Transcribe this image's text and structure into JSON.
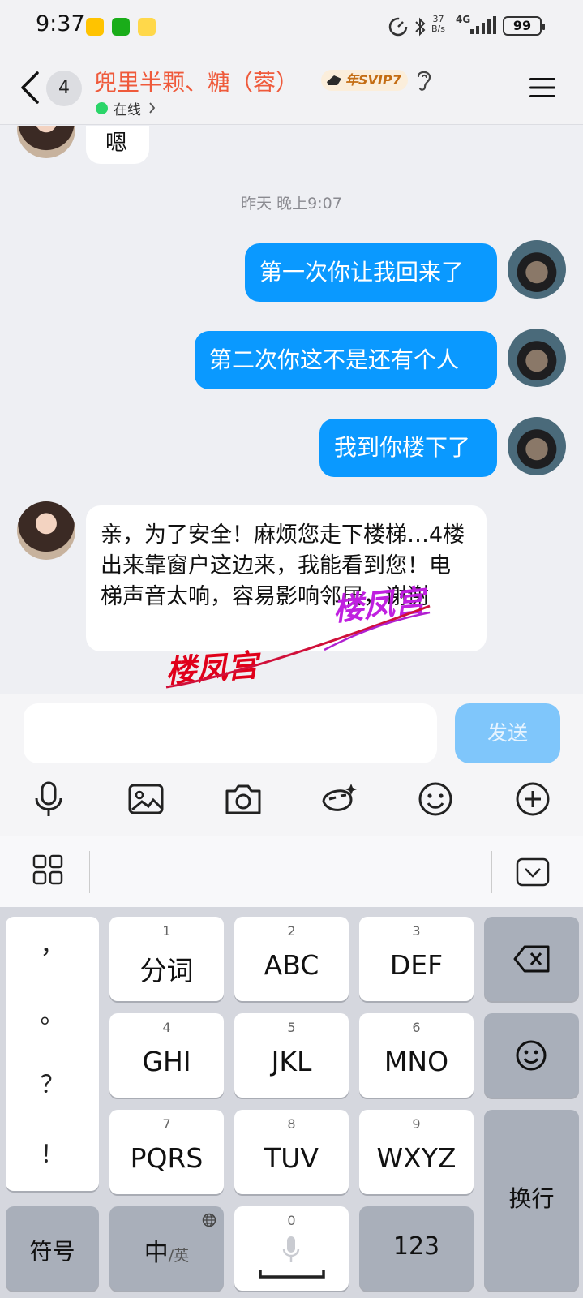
{
  "status": {
    "time": "9:37",
    "net_speed_top": "37",
    "net_speed_bottom": "B/s",
    "network": "4G",
    "battery": "99"
  },
  "header": {
    "unread_count": "4",
    "title": "兜里半颗、糖（蓉）",
    "vip_badge": "年SVIP7",
    "status": "在线"
  },
  "messages": {
    "m1": "嗯",
    "timestamp": "昨天 晚上9:07",
    "m2": "第一次你让我回来了",
    "m3": "第二次你这不是还有个人",
    "m4": "我到你楼下了",
    "m5": "亲，为了安全！麻烦您走下楼梯…4楼出来靠窗户这边来，我能看到您！电梯声音太响，容易影响邻居，谢谢"
  },
  "watermark": "楼凤宫",
  "input": {
    "placeholder": "",
    "send_label": "发送"
  },
  "toolbar": [
    "mic-icon",
    "image-icon",
    "camera-icon",
    "sticker-icon",
    "emoji-icon",
    "plus-icon"
  ],
  "keyboard": {
    "punct": [
      "，",
      "。",
      "？",
      "！"
    ],
    "keys": [
      {
        "num": "1",
        "label": "分词"
      },
      {
        "num": "2",
        "label": "ABC"
      },
      {
        "num": "3",
        "label": "DEF"
      },
      {
        "num": "4",
        "label": "GHI"
      },
      {
        "num": "5",
        "label": "JKL"
      },
      {
        "num": "6",
        "label": "MNO"
      },
      {
        "num": "7",
        "label": "PQRS"
      },
      {
        "num": "8",
        "label": "TUV"
      },
      {
        "num": "9",
        "label": "WXYZ"
      }
    ],
    "symbols": "符号",
    "lang_main": "中",
    "lang_alt": "/英",
    "space_num": "0",
    "num_key": "123",
    "enter": "换行"
  },
  "colors": {
    "outgoing_bubble": "#0a99ff",
    "title": "#ef5a3b",
    "online": "#2bd569",
    "send_button": "#7fc6fb"
  }
}
